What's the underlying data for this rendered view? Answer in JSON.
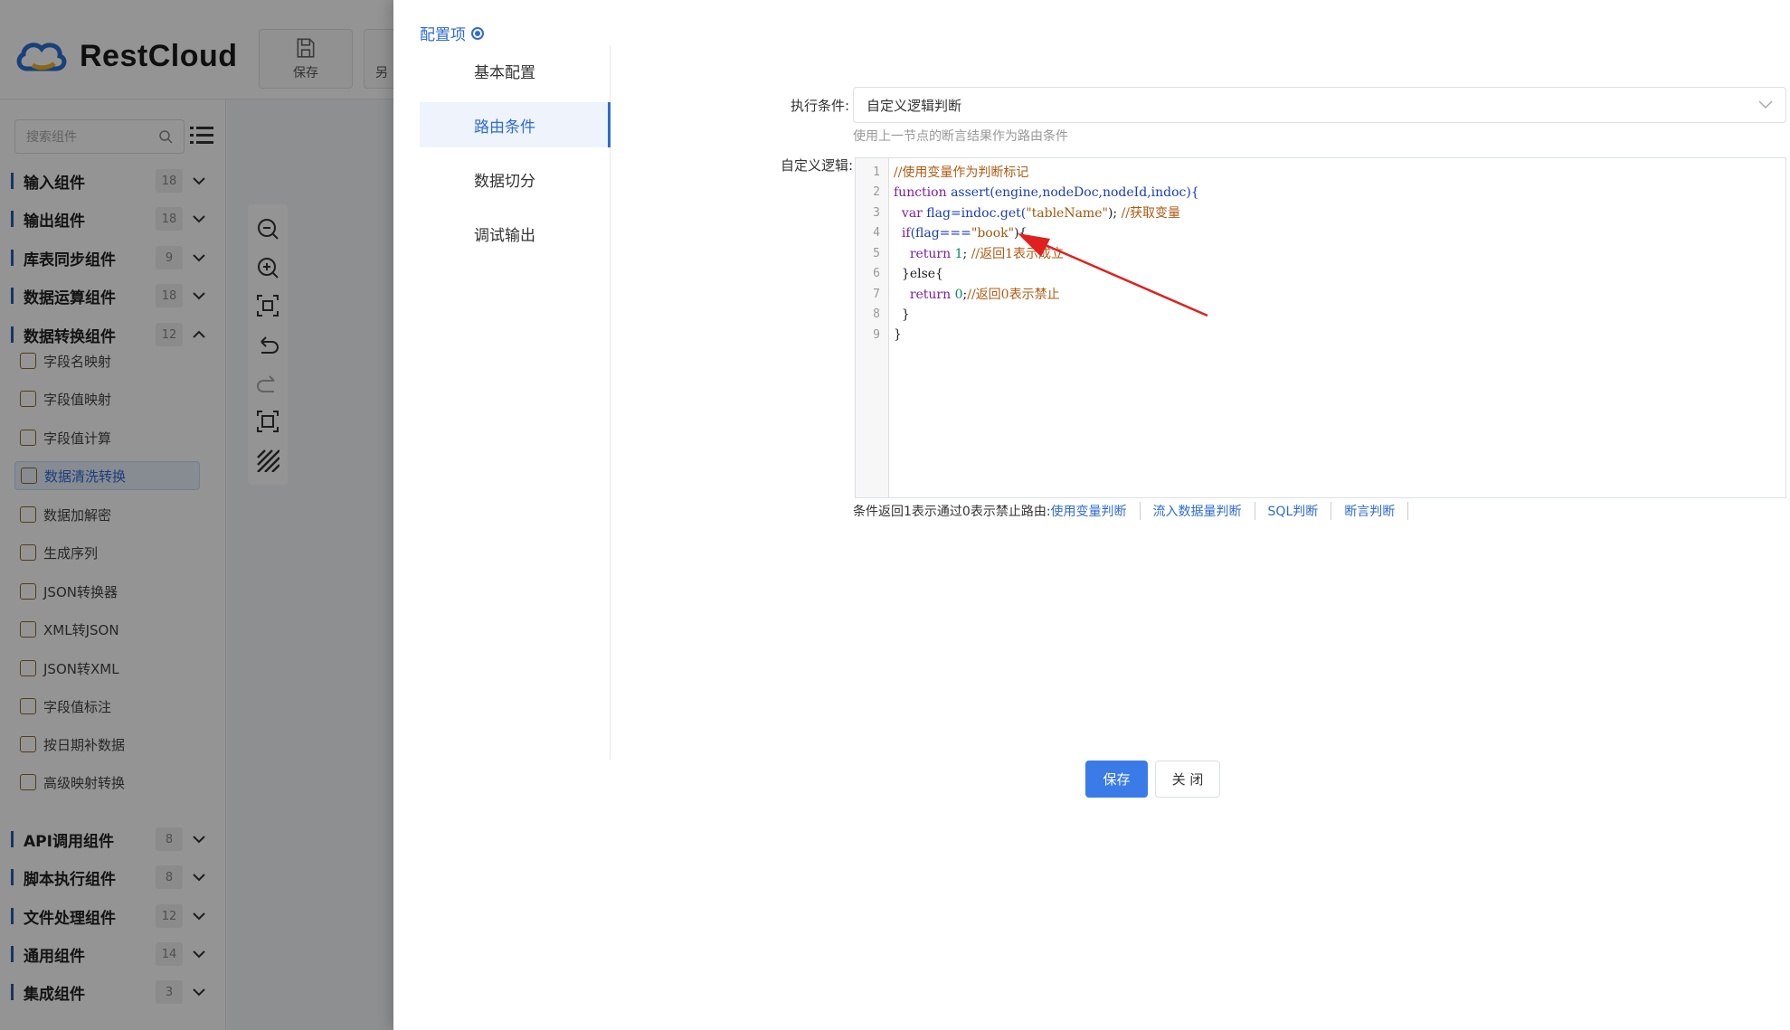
{
  "app": {
    "brand": "RestCloud",
    "toolbar": {
      "save_label": "保存",
      "next_label": "另"
    }
  },
  "sidebar": {
    "search_placeholder": "搜索组件",
    "categories": [
      {
        "label": "输入组件",
        "count": "18"
      },
      {
        "label": "输出组件",
        "count": "18"
      },
      {
        "label": "库表同步组件",
        "count": "9"
      },
      {
        "label": "数据运算组件",
        "count": "18"
      },
      {
        "label": "数据转换组件",
        "count": "12"
      },
      {
        "label": "API调用组件",
        "count": "8"
      },
      {
        "label": "脚本执行组件",
        "count": "8"
      },
      {
        "label": "文件处理组件",
        "count": "12"
      },
      {
        "label": "通用组件",
        "count": "14"
      },
      {
        "label": "集成组件",
        "count": "3"
      }
    ],
    "items": [
      "字段名映射",
      "字段值映射",
      "字段值计算",
      "数据清洗转换",
      "数据加解密",
      "生成序列",
      "JSON转换器",
      "XML转JSON",
      "JSON转XML",
      "字段值标注",
      "按日期补数据",
      "高级映射转换"
    ]
  },
  "drawer": {
    "title": "配置项",
    "tabs": [
      "基本配置",
      "路由条件",
      "数据切分",
      "调试输出"
    ],
    "condition_label": "执行条件:",
    "condition_value": "自定义逻辑判断",
    "condition_hint": "使用上一节点的断言结果作为路由条件",
    "logic_label": "自定义逻辑:",
    "code_line_numbers": [
      "1",
      "2",
      "3",
      "4",
      "5",
      "6",
      "7",
      "8",
      "9"
    ],
    "code_parts": {
      "l1_comment": "//使用变量作为判断标记",
      "l2_kw": "function",
      "l2_fn": "assert",
      "l2_args": "(engine,nodeDoc,nodeId,indoc){",
      "l3_kw": "var",
      "l3_a": " flag=indoc.get(",
      "l3_str": "\"tableName\"",
      "l3_b": "); ",
      "l3_comment": "//获取变量",
      "l4_kw": "if",
      "l4_a": "(flag===",
      "l4_str": "\"book\"",
      "l4_b": "){",
      "l5_kw": "return",
      "l5_num": "1",
      "l5_b": "; ",
      "l5_comment": "//返回1表示成立",
      "l6": "}else{",
      "l7_kw": "return",
      "l7_num": "0",
      "l7_b": ";",
      "l7_comment": "//返回0表示禁止",
      "l8": "}",
      "l9": "}"
    },
    "rule_text": "条件返回1表示通过0表示禁止路由:",
    "rule_links": [
      "使用变量判断",
      "流入数据量判断",
      "SQL判断",
      "断言判断"
    ],
    "save_label": "保存",
    "close_label": "关 闭"
  },
  "colors": {
    "accent": "#2f6bd6",
    "save_button": "#3b7be8",
    "annotation_arrow": "#e02020"
  }
}
